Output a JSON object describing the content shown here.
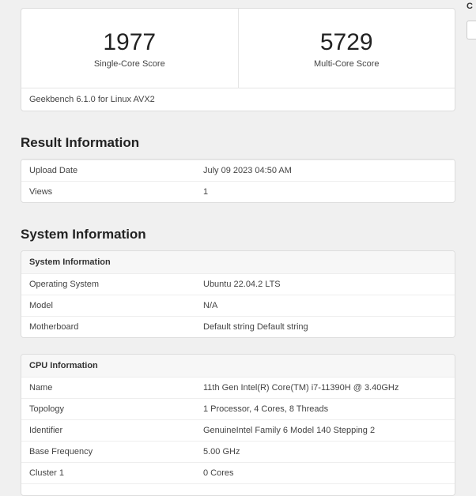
{
  "topRight": {
    "letter": "C"
  },
  "scores": {
    "single": {
      "value": "1977",
      "label": "Single-Core Score"
    },
    "multi": {
      "value": "5729",
      "label": "Multi-Core Score"
    },
    "footer": "Geekbench 6.1.0 for Linux AVX2"
  },
  "resultInfo": {
    "heading": "Result Information",
    "rows": [
      {
        "label": "Upload Date",
        "value": "July 09 2023 04:50 AM"
      },
      {
        "label": "Views",
        "value": "1"
      }
    ]
  },
  "systemInfo": {
    "heading": "System Information",
    "tableHeader": "System Information",
    "rows": [
      {
        "label": "Operating System",
        "value": "Ubuntu 22.04.2 LTS"
      },
      {
        "label": "Model",
        "value": "N/A"
      },
      {
        "label": "Motherboard",
        "value": "Default string Default string"
      }
    ]
  },
  "cpuInfo": {
    "tableHeader": "CPU Information",
    "rows": [
      {
        "label": "Name",
        "value": "11th Gen Intel(R) Core(TM) i7-11390H @ 3.40GHz"
      },
      {
        "label": "Topology",
        "value": "1 Processor, 4 Cores, 8 Threads"
      },
      {
        "label": "Identifier",
        "value": "GenuineIntel Family 6 Model 140 Stepping 2"
      },
      {
        "label": "Base Frequency",
        "value": "5.00 GHz"
      },
      {
        "label": "Cluster 1",
        "value": "0 Cores"
      }
    ]
  }
}
